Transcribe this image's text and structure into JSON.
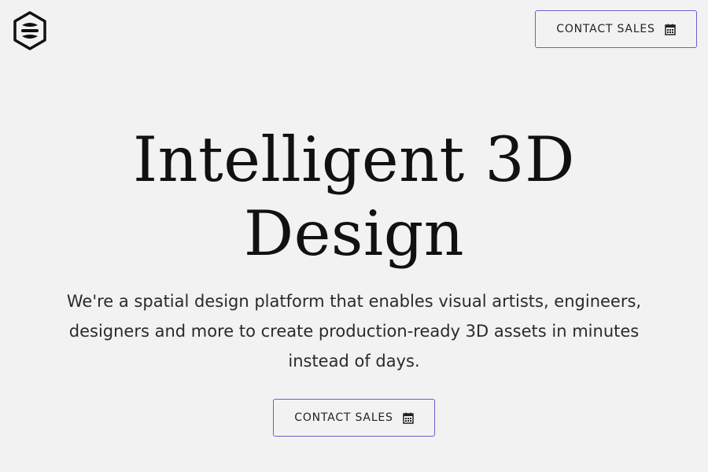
{
  "header": {
    "logo_icon": "hexagon-layers-icon",
    "contact_button_label": "CONTACT SALES",
    "contact_button_icon": "calendar-icon"
  },
  "hero": {
    "headline_line1": "Intelligent 3D",
    "headline_line2": "Design",
    "description": "We're a spatial design platform that enables visual artists, engineers, designers and more to create production-ready 3D assets in minutes instead of days.",
    "cta_label": "CONTACT SALES",
    "cta_icon": "calendar-icon"
  },
  "colors": {
    "background": "#f3f2f2",
    "button_border": "#6a5fd0",
    "text": "#1b1b1b"
  }
}
